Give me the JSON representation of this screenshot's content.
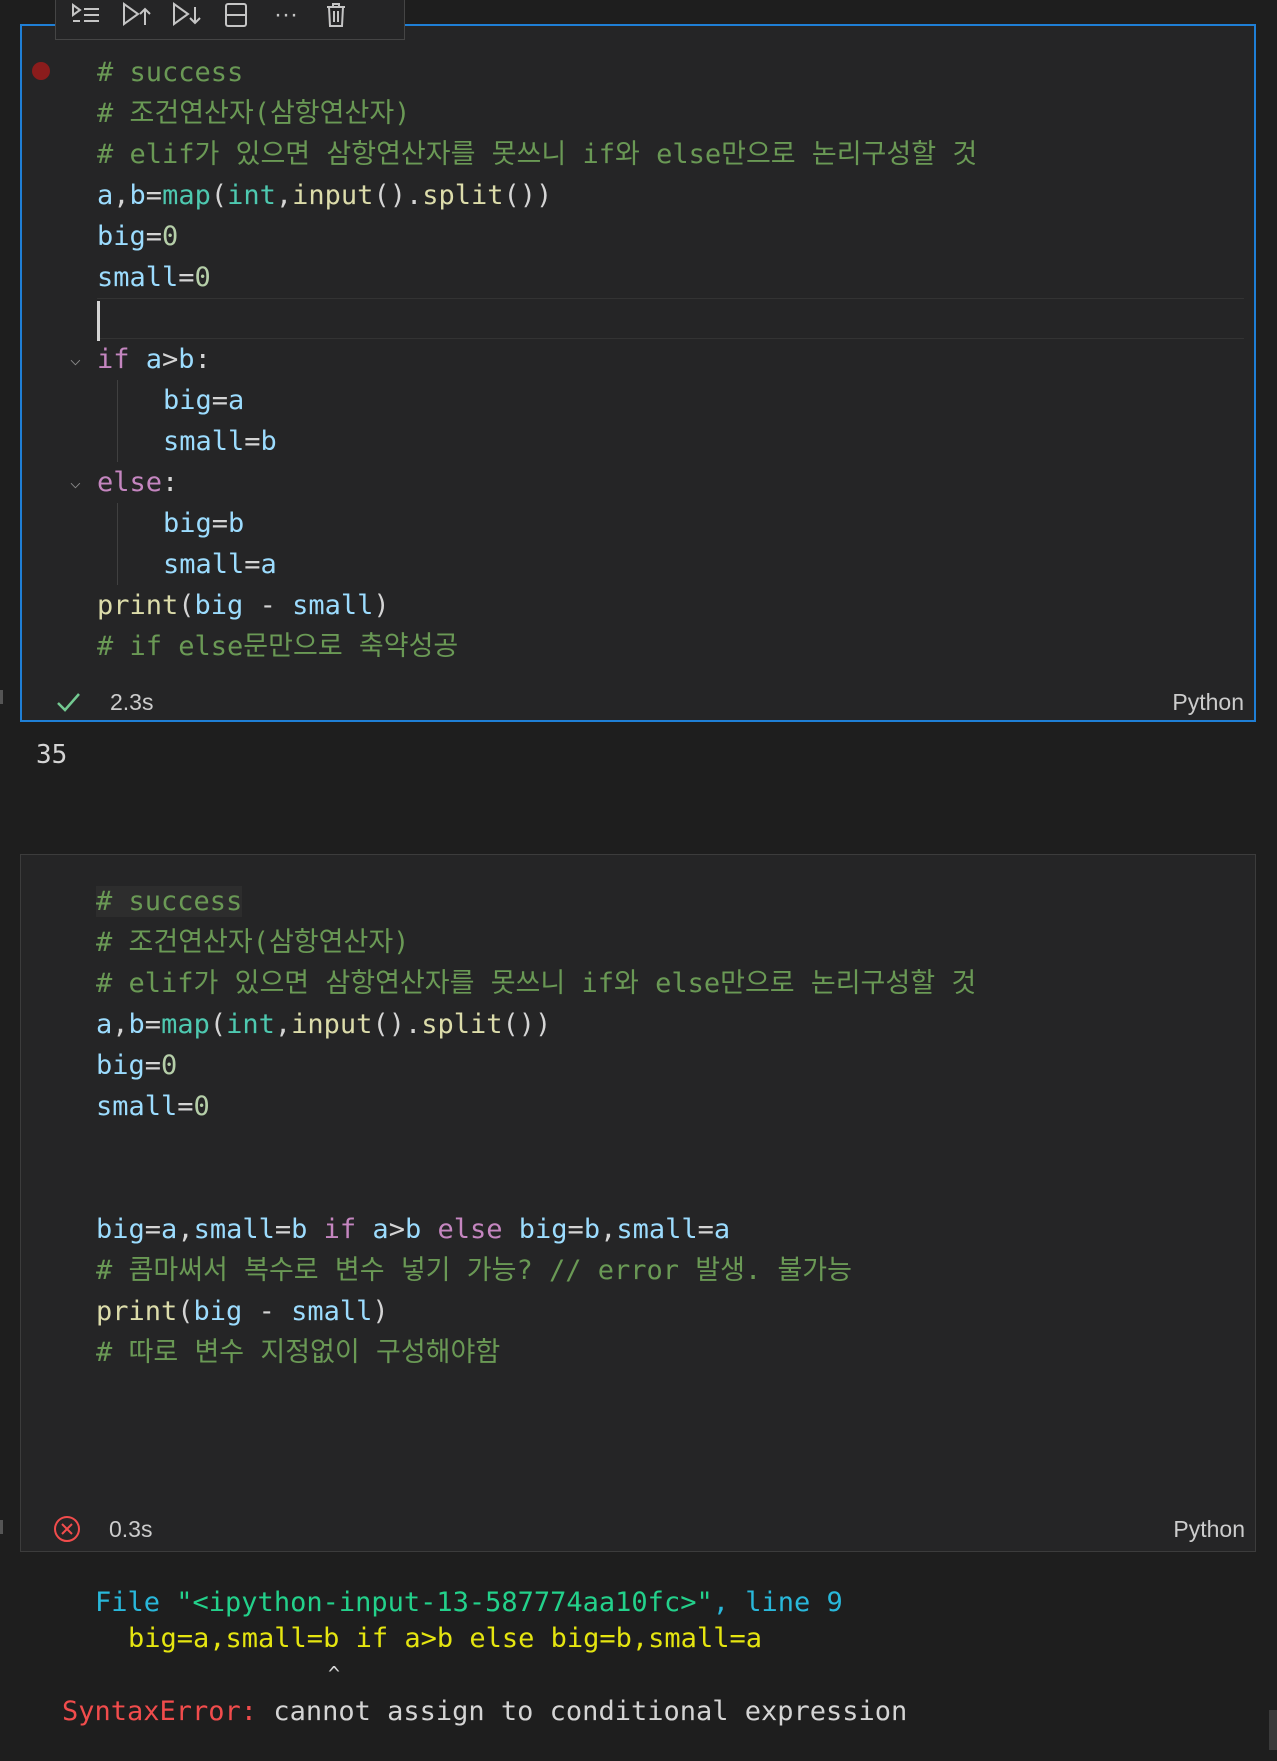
{
  "toolbar": {
    "items": [
      "run-by-line-icon",
      "execute-above-icon",
      "execute-below-icon",
      "split-cell-icon",
      "more-icon",
      "delete-icon"
    ],
    "more_label": "···"
  },
  "cell1": {
    "status_time": "2.3s",
    "language": "Python",
    "output": "35",
    "lines": {
      "l1": "# success",
      "l2": "# 조건연산자(삼항연산자)",
      "l3": "# elif가 있으면 삼항연산자를 못쓰니 if와 else만으로 논리구성할 것",
      "l4_a": "a",
      "l4_comma": ",",
      "l4_b": "b",
      "l4_eq": "=",
      "l4_map": "map",
      "l4_p1": "(",
      "l4_int": "int",
      "l4_comma2": ",",
      "l4_input": "input",
      "l4_p2": "().",
      "l4_split": "split",
      "l4_p3": "())",
      "l5_big": "big",
      "l5_eq": "=",
      "l5_num": "0",
      "l6_small": "small",
      "l6_eq": "=",
      "l6_num": "0",
      "l8_if": "if",
      "l8_a": " a",
      "l8_gt": ">",
      "l8_b": "b",
      "l8_colon": ":",
      "l9_big": "big",
      "l9_eq": "=",
      "l9_a": "a",
      "l10_small": "small",
      "l10_eq": "=",
      "l10_b": "b",
      "l11_else": "else",
      "l11_colon": ":",
      "l12_big": "big",
      "l12_eq": "=",
      "l12_b": "b",
      "l13_small": "small",
      "l13_eq": "=",
      "l13_a": "a",
      "l14_print": "print",
      "l14_p1": "(",
      "l14_big": "big",
      "l14_minus": " - ",
      "l14_small": "small",
      "l14_p2": ")",
      "l15": "# if else문만으로 축약성공"
    }
  },
  "cell2": {
    "status_time": "0.3s",
    "language": "Python",
    "lines": {
      "l1": "# success",
      "l2": "# 조건연산자(삼항연산자)",
      "l3": "# elif가 있으면 삼항연산자를 못쓰니 if와 else만으로 논리구성할 것",
      "l4_a": "a",
      "l4_comma": ",",
      "l4_b": "b",
      "l4_eq": "=",
      "l4_map": "map",
      "l4_p1": "(",
      "l4_int": "int",
      "l4_comma2": ",",
      "l4_input": "input",
      "l4_p2": "().",
      "l4_split": "split",
      "l4_p3": "())",
      "l5_big": "big",
      "l5_eq": "=",
      "l5_num": "0",
      "l6_small": "small",
      "l6_eq": "=",
      "l6_num": "0",
      "l9_big": "big",
      "l9_eq1": "=",
      "l9_a": "a",
      "l9_comma1": ",",
      "l9_small": "small",
      "l9_eq2": "=",
      "l9_b": "b",
      "l9_if": " if ",
      "l9_a2": "a",
      "l9_gt": ">",
      "l9_b2": "b",
      "l9_else": " else ",
      "l9_big2": "big",
      "l9_eq3": "=",
      "l9_b3": "b",
      "l9_comma2": ",",
      "l9_small2": "small",
      "l9_eq4": "=",
      "l9_a3": "a",
      "l10": "# 콤마써서 복수로 변수 넣기 가능? // error 발생. 불가능",
      "l11_print": "print",
      "l11_p1": "(",
      "l11_big": "big",
      "l11_minus": " - ",
      "l11_small": "small",
      "l11_p2": ")",
      "l12": "# 따로 변수 지정없이 구성해야함"
    },
    "traceback": {
      "file_prefix": "File ",
      "file_name": "\"<ipython-input-13-587774aa10fc>\"",
      "line_sep": ", ",
      "line_label": "line 9",
      "code": "big=a,small=b if a>b else big=b,small=a",
      "caret": "^",
      "error_type": "SyntaxError:",
      "error_msg": " cannot assign to conditional expression"
    }
  },
  "colors": {
    "accent_border": "#1f7fd6",
    "success": "#73c991",
    "error": "#f14c4c"
  }
}
